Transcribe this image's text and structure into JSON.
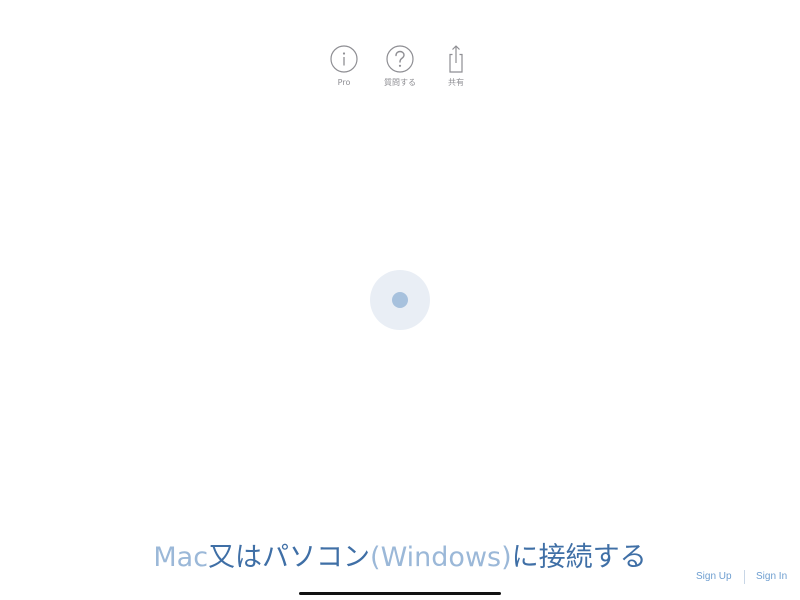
{
  "toolbar": {
    "items": [
      {
        "label": "Pro",
        "icon": "info-icon"
      },
      {
        "label": "質問する",
        "icon": "question-icon"
      },
      {
        "label": "共有",
        "icon": "share-icon"
      }
    ]
  },
  "loading": {
    "state": "connecting"
  },
  "headline": {
    "part1": "Mac",
    "part2": "又はパソコン",
    "part3": "(Windows)",
    "part4": "に接続する"
  },
  "auth": {
    "sign_up": "Sign Up",
    "sign_in": "Sign In"
  },
  "colors": {
    "accent": "#3f6fa6",
    "accent_light": "#9bb8d8",
    "link": "#6e9ed0",
    "icon_gray": "#8e8e93",
    "loader_bg": "#e9eef5",
    "loader_dot": "#a7c1dd"
  }
}
